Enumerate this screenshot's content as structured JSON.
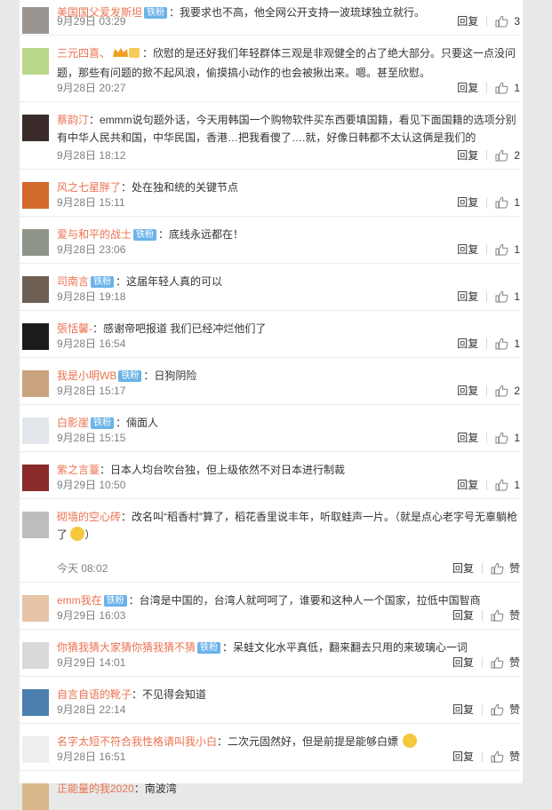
{
  "reply_label": "回复",
  "colors": {
    "username": "#eb7350",
    "badge": "#6bb3e8",
    "meta": "#808080"
  },
  "comments": [
    {
      "user": "美国国父爱发斯坦",
      "badge": "铁粉",
      "text": "：我要求也不高，他全网公开支持一波琉球独立就行。",
      "date": "9月29日 03:29",
      "likes": "3",
      "avatar_color": "#9a9590"
    },
    {
      "user": "三元四喜、",
      "badge": "",
      "crown": true,
      "text": "：欣慰的是还好我们年轻群体三观是非观健全的占了绝大部分。只要这一点没问题，那些有问题的掀不起风浪，偷摸搞小动作的也会被揪出来。嗯。甚至欣慰。",
      "date": "9月28日 20:27",
      "likes": "1",
      "avatar_color": "#b9d88a"
    },
    {
      "user": "蔡韵汀",
      "badge": "",
      "text": "：emmm说句题外话，今天用韩国一个购物软件买东西要填国籍，看见下面国籍的选项分别有中华人民共和国，中华民国，香港…把我看傻了….就，好像日韩都不太认这俩是我们的",
      "date": "9月28日 18:12",
      "likes": "2",
      "avatar_color": "#3a2a2a"
    },
    {
      "user": "风之七星胖了",
      "badge": "",
      "text": "：处在独和统的关键节点",
      "date": "9月28日 15:11",
      "likes": "1",
      "avatar_color": "#d26a2c"
    },
    {
      "user": "爱与和平的战士",
      "badge": "铁粉",
      "text": "：底线永远都在！",
      "date": "9月28日 23:06",
      "likes": "1",
      "avatar_color": "#8f9588"
    },
    {
      "user": "司南言",
      "badge": "铁粉",
      "text": "：这届年轻人真的可以",
      "date": "9月28日 19:18",
      "likes": "1",
      "avatar_color": "#6e5f55"
    },
    {
      "user": "張恬馨-",
      "badge": "",
      "text": "：感谢帝吧报道 我们已经冲烂他们了",
      "date": "9月28日 16:54",
      "likes": "1",
      "avatar_color": "#1c1c1c"
    },
    {
      "user": "我是小明WB",
      "badge": "铁粉",
      "text": "：日狗阴险",
      "date": "9月28日 15:17",
      "likes": "2",
      "avatar_color": "#c9a27e"
    },
    {
      "user": "白影崖",
      "badge": "铁粉",
      "text": "：倆面人",
      "date": "9月28日 15:15",
      "likes": "1",
      "avatar_color": "#e2e6ea"
    },
    {
      "user": "紫之言薹",
      "badge": "",
      "text": "：日本人均台吹台独，但上级依然不对日本进行制裁",
      "date": "9月29日 10:50",
      "likes": "1",
      "avatar_color": "#8a2a2a"
    },
    {
      "user": "砌墙的空心砖",
      "badge": "",
      "text": "：改名叫“稻香村”算了，稻花香里说丰年，听取蛙声一片。（就是点心老字号无辜躺枪了",
      "emoji_end": "）",
      "date": "今天 08:02",
      "likes": "赞",
      "avatar_color": "#bdbdbd"
    },
    {
      "user": "emm我在",
      "badge": "铁粉",
      "text": "：台湾是中国的，台湾人就呵呵了，谁要和这种人一个国家，拉低中国智商",
      "date": "9月29日 16:03",
      "likes": "赞",
      "avatar_color": "#e7c4a8"
    },
    {
      "user": "你猜我猜大家猜你猜我猜不猜",
      "badge": "铁粉",
      "text": "：呆蛙文化水平真低，翻来翻去只用的来玻璃心一词",
      "date": "9月29日 14:01",
      "likes": "赞",
      "avatar_color": "#d9d9d9"
    },
    {
      "user": "自言自语的靴子",
      "badge": "",
      "text": "：不见得会知道",
      "date": "9月28日 22:14",
      "likes": "赞",
      "avatar_color": "#4a7fae"
    },
    {
      "user": "名字太短不符合我性格请叫我小白",
      "badge": "",
      "text": "：二次元固然好，但是前提是能够白嫖",
      "emoji_after": true,
      "date": "9月28日 16:51",
      "likes": "赞",
      "avatar_color": "#eeeeee"
    },
    {
      "user": "正能量的我2020",
      "badge": "",
      "text": "：南波湾",
      "date": "",
      "likes": "",
      "avatar_color": "#d8b88a"
    }
  ]
}
